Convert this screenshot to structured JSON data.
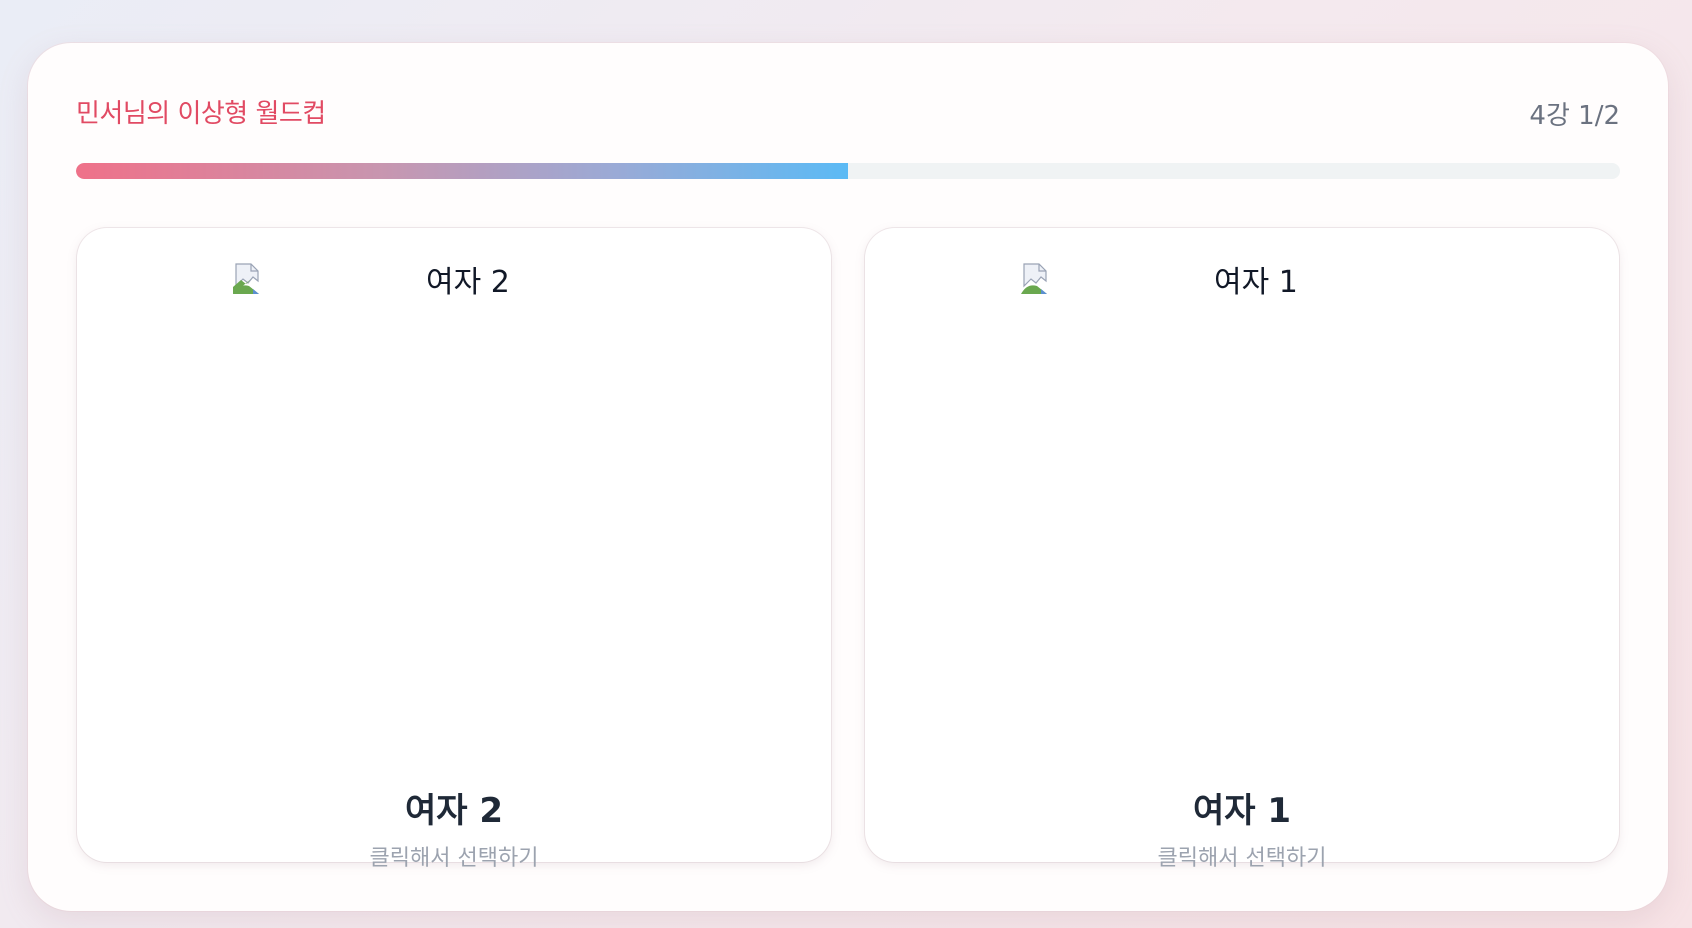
{
  "header": {
    "title": "민서님의 이상형 월드컵",
    "round": "4강 1/2"
  },
  "progress": {
    "fraction": 0.5
  },
  "cards": [
    {
      "image_alt": "여자 2",
      "name": "여자 2",
      "hint": "클릭해서 선택하기"
    },
    {
      "image_alt": "여자 1",
      "name": "여자 1",
      "hint": "클릭해서 선택하기"
    }
  ],
  "colors": {
    "accent": "#e14a63",
    "progress_start": "#ef7189",
    "progress_end": "#5bbaf5"
  }
}
